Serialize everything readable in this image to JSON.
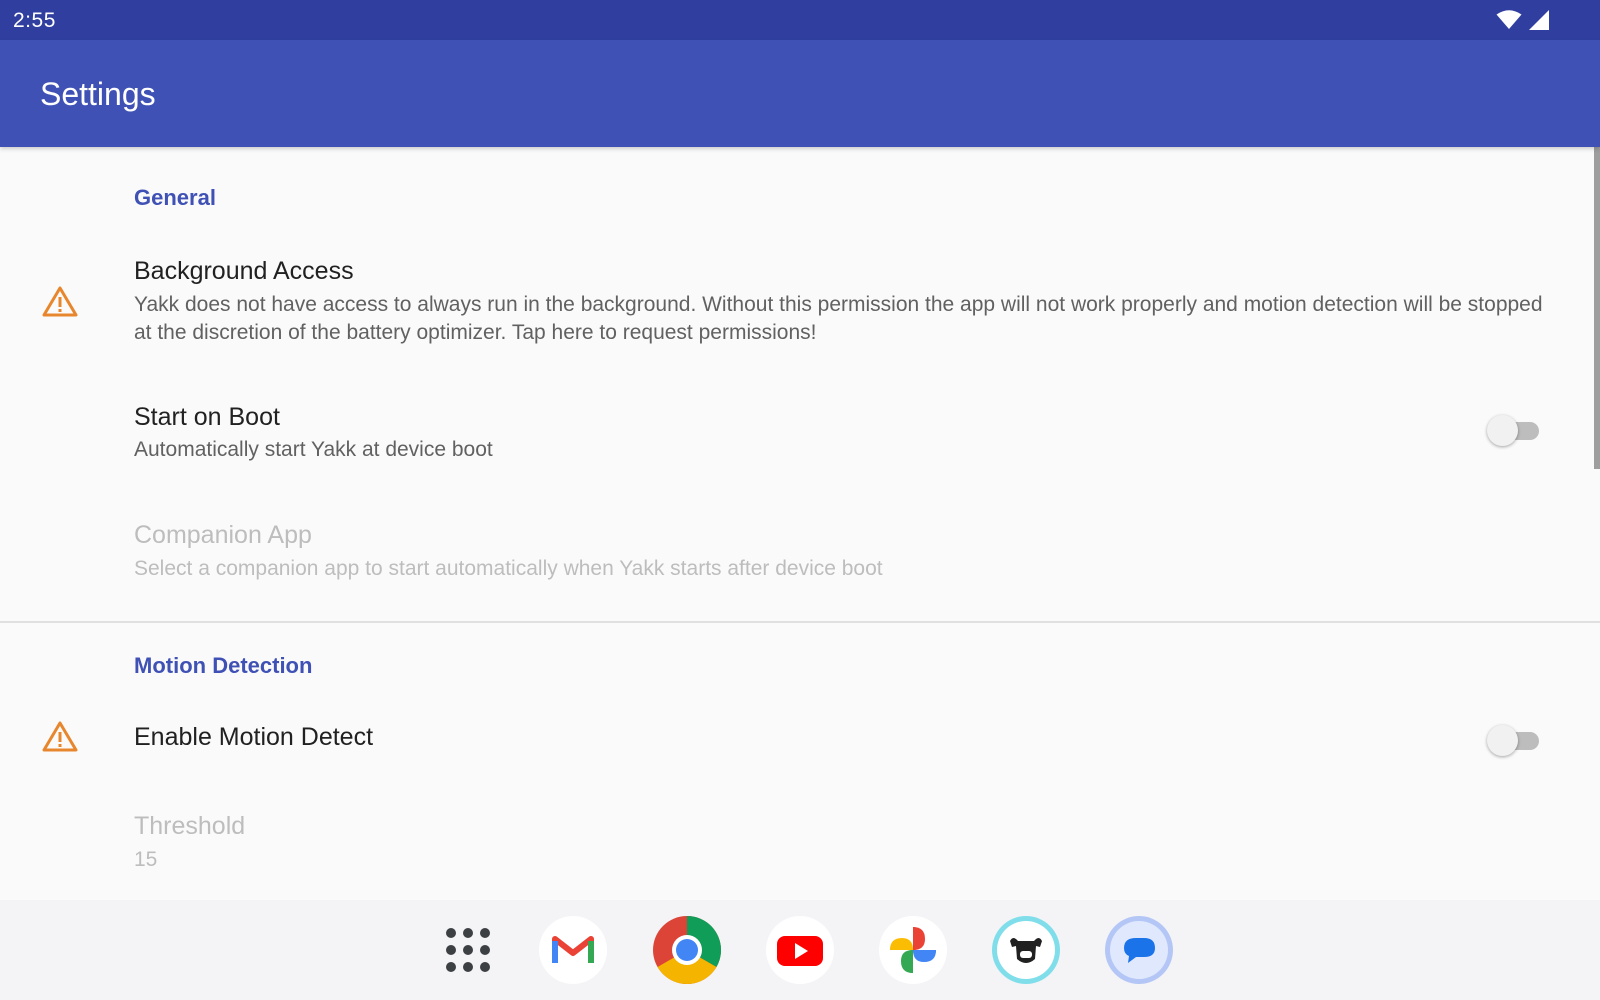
{
  "status_bar": {
    "time": "2:55",
    "icons": [
      "wifi-icon",
      "cell-signal-icon"
    ]
  },
  "app_bar": {
    "title": "Settings"
  },
  "colors": {
    "status_bar": "#303f9f",
    "app_bar": "#3f51b5",
    "accent": "#3f51b5",
    "warning": "#e8862e",
    "disabled_text": "#bdbdbd"
  },
  "sections": {
    "general": {
      "header": "General",
      "background_access": {
        "icon": "warning-icon",
        "title": "Background Access",
        "summary": "Yakk does not have access to always run in the background. Without this permission the app will not work properly and motion detection will be stopped at the discretion of the battery optimizer. Tap here to request permissions!"
      },
      "start_on_boot": {
        "title": "Start on Boot",
        "summary": "Automatically start Yakk at device boot",
        "enabled": false
      },
      "companion_app": {
        "title": "Companion App",
        "summary": "Select a companion app to start automatically when Yakk starts after device boot",
        "disabled": true
      }
    },
    "motion_detection": {
      "header": "Motion Detection",
      "enable_motion_detect": {
        "icon": "warning-icon",
        "title": "Enable Motion Detect",
        "enabled": false
      },
      "threshold": {
        "title": "Threshold",
        "value": "15",
        "disabled": true
      }
    }
  },
  "dock": {
    "apps": [
      "app-drawer-icon",
      "gmail-icon",
      "chrome-icon",
      "youtube-icon",
      "photos-icon",
      "yakk-icon",
      "messages-icon"
    ]
  }
}
